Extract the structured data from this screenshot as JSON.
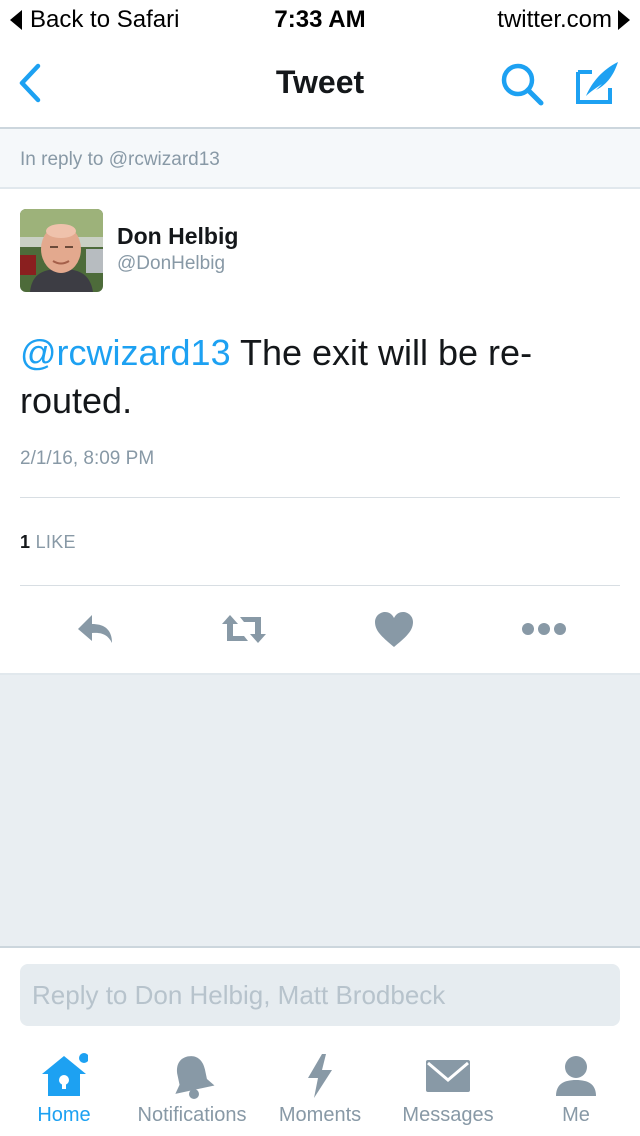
{
  "status_bar": {
    "back_label": "Back to Safari",
    "time": "7:33 AM",
    "site": "twitter.com"
  },
  "nav": {
    "title": "Tweet",
    "back_icon": "chevron-left-icon",
    "search_icon": "search-icon",
    "compose_icon": "compose-tweet-icon"
  },
  "reply_context": {
    "text": "In reply to @rcwizard13"
  },
  "tweet": {
    "author_name": "Don Helbig",
    "author_handle": "@DonHelbig",
    "mention": "@rcwizard13",
    "body": " The exit will be re-routed.",
    "timestamp": "2/1/16, 8:09 PM",
    "like_count": "1",
    "like_label": "LIKE",
    "actions": [
      "reply-icon",
      "retweet-icon",
      "like-heart-icon",
      "more-icon"
    ]
  },
  "composer": {
    "placeholder": "Reply to Don Helbig, Matt Brodbeck"
  },
  "tabbar": {
    "tabs": [
      {
        "label": "Home",
        "icon": "home-icon"
      },
      {
        "label": "Notifications",
        "icon": "bell-icon"
      },
      {
        "label": "Moments",
        "icon": "lightning-icon"
      },
      {
        "label": "Messages",
        "icon": "envelope-icon"
      },
      {
        "label": "Me",
        "icon": "person-icon"
      }
    ]
  },
  "colors": {
    "accent": "#1da1f2",
    "muted": "#8899a6",
    "text": "#14171a",
    "background": "#e9eef2"
  }
}
